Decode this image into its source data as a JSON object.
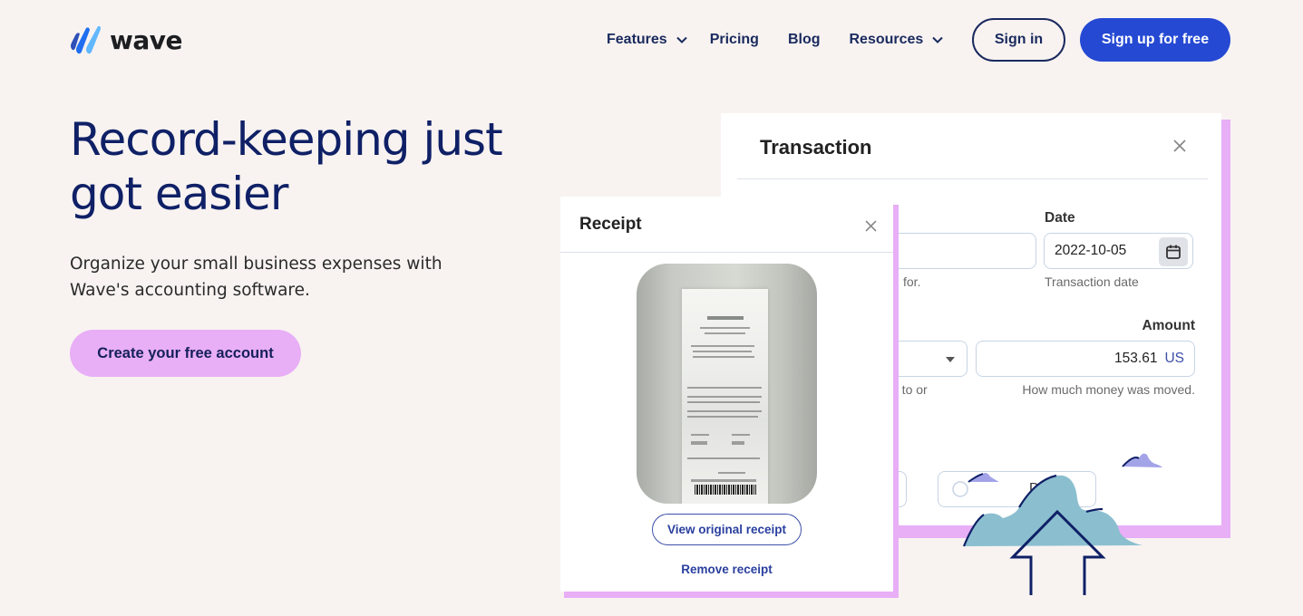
{
  "header": {
    "logo_text": "wave",
    "nav": [
      {
        "label": "Features",
        "has_dropdown": true
      },
      {
        "label": "Pricing",
        "has_dropdown": false
      },
      {
        "label": "Blog",
        "has_dropdown": false
      },
      {
        "label": "Resources",
        "has_dropdown": true
      }
    ],
    "sign_in_label": "Sign in",
    "sign_up_label": "Sign up for free"
  },
  "hero": {
    "title_line1": "Record-keeping just",
    "title_line2": "got easier",
    "subtitle_line1": "Organize your small business expenses with",
    "subtitle_line2": "Wave's accounting software.",
    "cta_label": "Create your free account"
  },
  "transaction_panel": {
    "title": "Transaction",
    "description_help_partial": "for.",
    "date_label": "Date",
    "date_value": "2022-10-05",
    "date_help": "Transaction date",
    "account_help_partial": "g to or",
    "amount_label": "Amount",
    "amount_value": "153.61",
    "amount_currency": "US",
    "amount_help": "How much money was moved.",
    "toggle_partial_label": "D"
  },
  "receipt_panel": {
    "title": "Receipt",
    "view_label": "View original receipt",
    "remove_label": "Remove receipt"
  },
  "colors": {
    "background": "#f8f3f1",
    "brand_navy": "#0f2066",
    "primary_blue": "#2549d3",
    "accent_pink": "#e8aef6",
    "cloud_teal": "#8bbfd0",
    "cloud_lavender": "#a3a3e8"
  },
  "icons": {
    "logo": "wave-logo-icon",
    "chevron": "chevron-down-icon",
    "close": "close-icon",
    "calendar": "calendar-icon",
    "dropdown": "caret-down-icon",
    "upload": "cloud-upload-illustration"
  }
}
